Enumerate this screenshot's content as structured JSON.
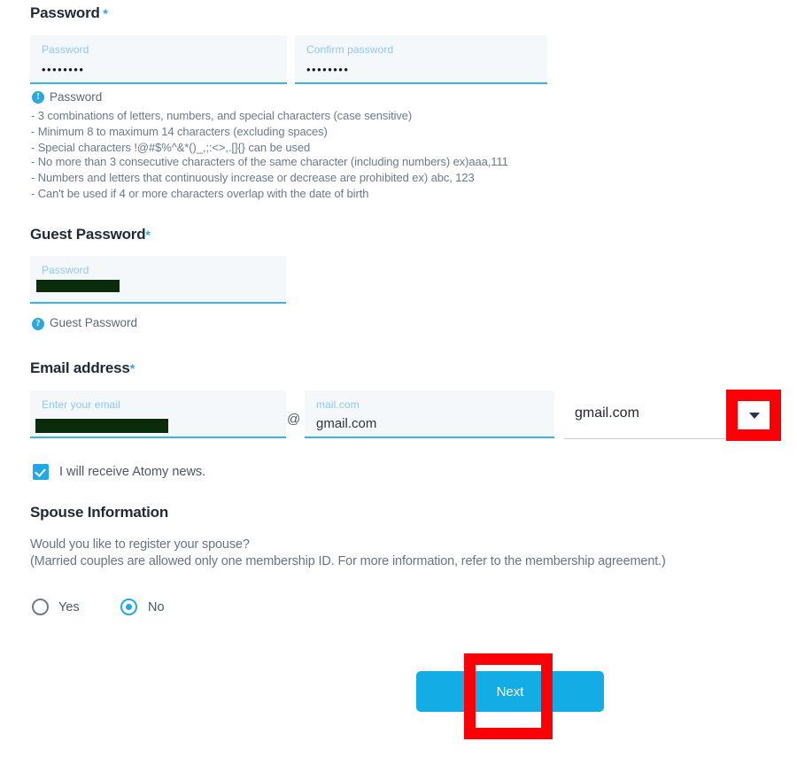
{
  "password_section": {
    "heading": "Password",
    "required_mark": "*",
    "fields": [
      {
        "label": "Password",
        "value": "••••••••",
        "placeholder": "Password"
      },
      {
        "label": "Confirm password",
        "value": "••••••••",
        "placeholder": "Confirm password"
      }
    ],
    "hint_title": "Password",
    "hint_icon": "!",
    "rules": [
      "- 3 combinations of letters, numbers, and special characters (case sensitive)",
      "- Minimum 8 to maximum 14 characters (excluding spaces)",
      "- Special characters !@#$%^&*()_,;:<>,.[]{} can be used",
      "- No more than 3 consecutive characters of the same character (including numbers) ex)aaa,111",
      "- Numbers and letters that continuously increase or decrease are prohibited ex) abc, 123",
      "- Can't be used if 4 or more characters overlap with the date of birth"
    ]
  },
  "guest_password_section": {
    "heading": "Guest Password",
    "required_mark": "*",
    "field": {
      "label": "Password",
      "value": "",
      "placeholder": "Password"
    },
    "hint_title": "Guest Password",
    "hint_icon": "?"
  },
  "email_section": {
    "heading": "Email address",
    "required_mark": "*",
    "local_field": {
      "label": "Enter your email",
      "value": "",
      "placeholder": "Enter your email"
    },
    "at_symbol": "@",
    "domain_field": {
      "label": "mail.com",
      "value": "gmail.com",
      "placeholder": "mail.com"
    },
    "domain_select": {
      "value": "gmail.com",
      "arrow_icon": "chevron-down-icon"
    },
    "newsletter": {
      "label": "I will receive Atomy news.",
      "checked": true
    }
  },
  "spouse_section": {
    "heading": "Spouse Information",
    "question": "Would you like to register your spouse?",
    "note": "(Married couples are allowed only one membership ID. For more information, refer to the membership agreement.)",
    "options": [
      {
        "label": "Yes",
        "selected": false
      },
      {
        "label": "No",
        "selected": true
      }
    ]
  },
  "footer": {
    "next_label": "Next"
  },
  "colors": {
    "accent": "#22a8e8",
    "field_bg": "#f4f8fb",
    "field_underline": "#35b4e8",
    "annotation_red": "#fb0007",
    "redaction": "#0b2c0b",
    "heading": "#1f2937"
  }
}
